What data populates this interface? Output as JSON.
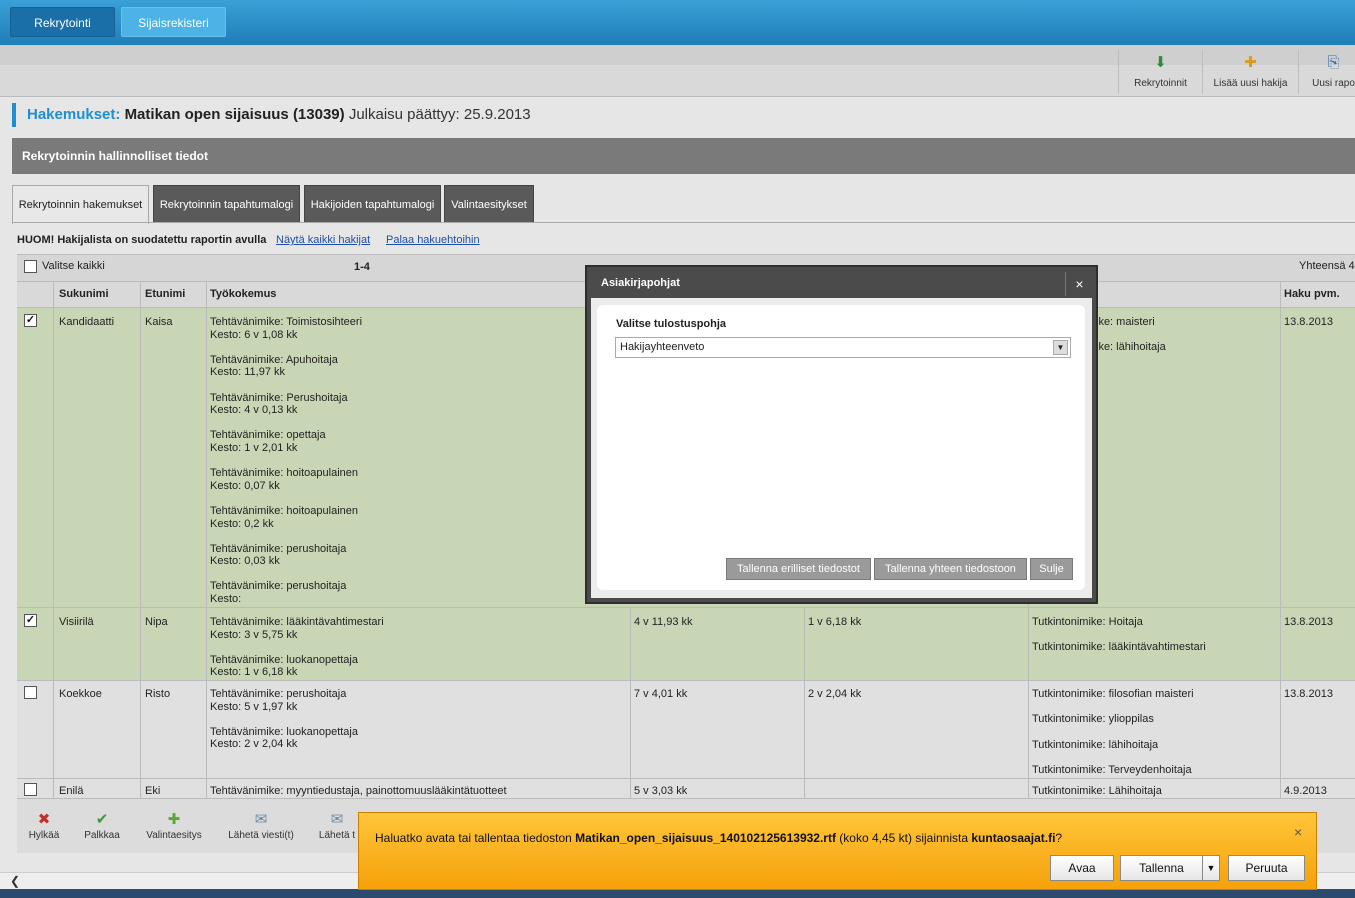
{
  "top_tabs": [
    "Rekrytointi",
    "Sijaisrekisteri"
  ],
  "toolbar": {
    "rekrytoinnit": "Rekrytoinnit",
    "lisaa": "Lisää uusi hakija",
    "uusi": "Uusi rapo"
  },
  "title": {
    "label": "Hakemukset:",
    "name": "Matikan open sijaisuus (13039)",
    "rest": "Julkaisu päättyy: 25.9.2013"
  },
  "section": "Rekrytoinnin hallinnolliset tiedot",
  "tabs": [
    "Rekrytoinnin hakemukset",
    "Rekrytoinnin tapahtumalogi",
    "Hakijoiden tapahtumalogi",
    "Valintaesitykset"
  ],
  "notice": {
    "text": "HUOM! Hakijalista on suodatettu raportin avulla",
    "show_all": "Näytä kaikki hakijat",
    "back": "Palaa hakuehtoihin"
  },
  "table": {
    "select_all": "Valitse kaikki",
    "range": "1-4",
    "total": "Yhteensä 4",
    "headers": {
      "sukunimi": "Sukunimi",
      "etunimi": "Etunimi",
      "tyokokemus": "Työkokemus",
      "haku": "Haku pvm."
    },
    "rows": [
      {
        "checked": "✓",
        "sukunimi": "Kandidaatti",
        "etunimi": "Kaisa",
        "experience": [
          [
            "Tehtävänimike: Toimistosihteeri",
            "Kesto: 6 v 1,08 kk"
          ],
          [
            "Tehtävänimike: Apuhoitaja",
            "Kesto: 11,97 kk"
          ],
          [
            "Tehtävänimike: Perushoitaja",
            "Kesto: 4 v 0,13 kk"
          ],
          [
            "Tehtävänimike: opettaja",
            "Kesto: 1 v 2,01 kk"
          ],
          [
            "Tehtävänimike: hoitoapulainen",
            "Kesto: 0,07 kk"
          ],
          [
            "Tehtävänimike: hoitoapulainen",
            "Kesto: 0,2 kk"
          ],
          [
            "Tehtävänimike: perushoitaja",
            "Kesto: 0,03 kk"
          ],
          [
            "Tehtävänimike: perushoitaja",
            "Kesto:"
          ]
        ],
        "total": "",
        "relevant": "",
        "degrees": [
          "ike: maisteri",
          "ike: lähihoitaja"
        ],
        "date": "13.8.2013"
      },
      {
        "checked": "✓",
        "sukunimi": "Visiirilä",
        "etunimi": "Nipa",
        "experience": [
          [
            "Tehtävänimike: lääkintävahtimestari",
            "Kesto: 3 v 5,75 kk"
          ],
          [
            "Tehtävänimike: luokanopettaja",
            "Kesto: 1 v 6,18 kk"
          ]
        ],
        "total": "4 v 11,93 kk",
        "relevant": "1 v 6,18 kk",
        "degrees": [
          "Tutkintonimike: Hoitaja",
          "Tutkintonimike: lääkintävahtimestari"
        ],
        "date": "13.8.2013"
      },
      {
        "checked": "",
        "sukunimi": "Koekkoe",
        "etunimi": "Risto",
        "experience": [
          [
            "Tehtävänimike: perushoitaja",
            "Kesto: 5 v 1,97 kk"
          ],
          [
            "Tehtävänimike: luokanopettaja",
            "Kesto: 2 v 2,04 kk"
          ]
        ],
        "total": "7 v 4,01 kk",
        "relevant": "2 v 2,04 kk",
        "degrees": [
          "Tutkintonimike: filosofian maisteri",
          "Tutkintonimike: ylioppilas",
          "Tutkintonimike: lähihoitaja",
          "Tutkintonimike: Terveydenhoitaja"
        ],
        "date": "13.8.2013"
      },
      {
        "checked": "",
        "sukunimi": "Enilä",
        "etunimi": "Eki",
        "experience": [
          [
            "Tehtävänimike: myyntiedustaja, painottomuuslääkintätuotteet"
          ]
        ],
        "total": "5 v 3,03 kk",
        "relevant": "",
        "degrees": [
          "Tutkintonimike: Lähihoitaja"
        ],
        "date": "4.9.2013"
      }
    ]
  },
  "actions": [
    "Hylkää",
    "Palkkaa",
    "Valintaesitys",
    "Lähetä viesti(t)",
    "Lähetä t"
  ],
  "modal": {
    "title": "Asiakirjapohjat",
    "close": "×",
    "label": "Valitse tulostuspohja",
    "selected": "Hakijayhteenveto",
    "btn_separate": "Tallenna erilliset tiedostot",
    "btn_single": "Tallenna yhteen tiedostoon",
    "btn_close": "Sulje"
  },
  "download": {
    "pre": "Haluatko avata tai tallentaa tiedoston ",
    "file": "Matikan_open_sijaisuus_140102125613932.rtf",
    "mid": " (koko 4,45 kt) sijainnista ",
    "site": "kuntaosaajat.fi",
    "post": "?",
    "open": "Avaa",
    "save": "Tallenna",
    "dropdown": "▼",
    "cancel": "Peruuta",
    "close": "×"
  },
  "icons": {
    "download": "⬇",
    "add_user": "✚",
    "report": "⎘",
    "reject": "✖",
    "hire": "✔",
    "proposal": "✚",
    "mail": "✉",
    "send": "✉",
    "scroll_left": "❮"
  }
}
